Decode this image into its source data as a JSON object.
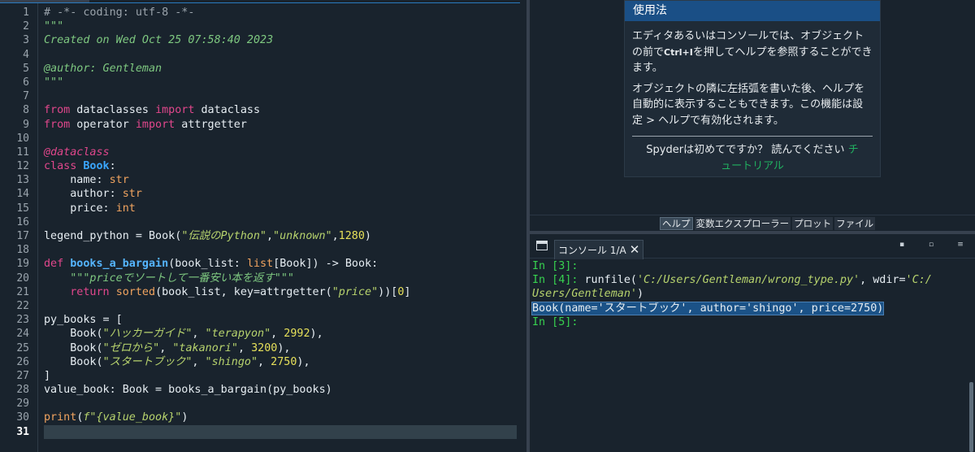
{
  "editor": {
    "line_numbers": [
      "1",
      "2",
      "3",
      "4",
      "5",
      "6",
      "7",
      "8",
      "9",
      "10",
      "11",
      "12",
      "13",
      "14",
      "15",
      "16",
      "17",
      "18",
      "19",
      "20",
      "21",
      "22",
      "23",
      "24",
      "25",
      "26",
      "27",
      "28",
      "29",
      "30",
      "31"
    ],
    "current_line": "31",
    "code": {
      "l1": "# -*- coding: utf-8 -*-",
      "l2": "\"\"\"",
      "l3": "Created on Wed Oct 25 07:58:40 2023",
      "l5": "@author: Gentleman",
      "l6": "\"\"\"",
      "kw_from": "from",
      "kw_import": "import",
      "mod_dataclasses": " dataclasses ",
      "name_dataclass": " dataclass",
      "mod_operator": " operator ",
      "name_attrgetter": " attrgetter",
      "decorator": "@dataclass",
      "kw_class": "class",
      "class_name": "Book",
      "colon": ":",
      "indent_name": "    name: ",
      "type_str": "str",
      "indent_author": "    author: ",
      "indent_price": "    price: ",
      "type_int": "int",
      "legend_lhs": "legend_python = Book(",
      "s_legend": "\"伝説のPython\"",
      "comma": ",",
      "s_unknown": "\"unknown\"",
      "n_1280": "1280",
      "close_paren": ")",
      "kw_def": "def",
      "fn_name": "books_a_bargain",
      "def_args_a": "(book_list: ",
      "type_list": "list",
      "def_args_b": "[Book]) -> Book:",
      "docstring": "    \"\"\"priceでソートして一番安い本を返す\"\"\"",
      "ret_indent": "    ",
      "kw_return": "return",
      "sp": " ",
      "fn_sorted": "sorted",
      "ret_mid": "(book_list, key=attrgetter(",
      "s_price": "\"price\"",
      "ret_end_a": "))[",
      "n_0": "0",
      "ret_end_b": "]",
      "py_books_open": "py_books = [",
      "book_indent": "    Book(",
      "s_hacker": "\"ハッカーガイド\"",
      "sep": ", ",
      "s_terapyon": "\"terapyon\"",
      "n_2992": "2992",
      "row_end": "),",
      "s_zero": "\"ゼロから\"",
      "s_takanori": "\"takanori\"",
      "n_3200": "3200",
      "s_start": "\"スタートブック\"",
      "s_shingo": "\"shingo\"",
      "n_2750": "2750",
      "py_books_close": "]",
      "value_book_line": "value_book: Book = books_a_bargain(py_books)",
      "fn_print": "print",
      "print_open": "(",
      "fstring": "f\"{value_book}\"",
      "print_close": ")"
    }
  },
  "help": {
    "title": "使用法",
    "para1_a": "エディタあるいはコンソールでは、オブジェクトの前で",
    "para1_key": "Ctrl+I",
    "para1_b": "を押してヘルプを参照することができます。",
    "para2": "オブジェクトの隣に左括弧を書いた後、ヘルプを自動的に表示することもできます。この機能は設定 > ヘルプで有効化されます。",
    "footer_text": "Spyderは初めてですか？ 読んでください ",
    "footer_link": "チュートリアル"
  },
  "pane_tabs": [
    {
      "label": "ヘルプ",
      "active": true
    },
    {
      "label": "変数エクスプローラー",
      "active": false
    },
    {
      "label": "プロット",
      "active": false
    },
    {
      "label": "ファイル",
      "active": false
    }
  ],
  "console": {
    "tab_label": "コンソール 1/A",
    "in3": "In [3]:",
    "in4": "In [4]:",
    "runfile_a": " runfile(",
    "path1": "'C:/Users/Gentleman/wrong_type.py'",
    "runfile_b": ", wdir=",
    "path2a": "'C:/",
    "path2b": "Users/Gentleman'",
    "runfile_c": ")",
    "output": "Book(name='スタートブック', author='shingo', price=2750)",
    "in5": "In [5]:"
  },
  "colors": {
    "background": "#19232d",
    "help_header": "#1a4f86",
    "prompt": "#37d14f",
    "keyword": "#e1478c",
    "string": "#b7d36d",
    "number": "#e6e05a",
    "link": "#21b060"
  }
}
